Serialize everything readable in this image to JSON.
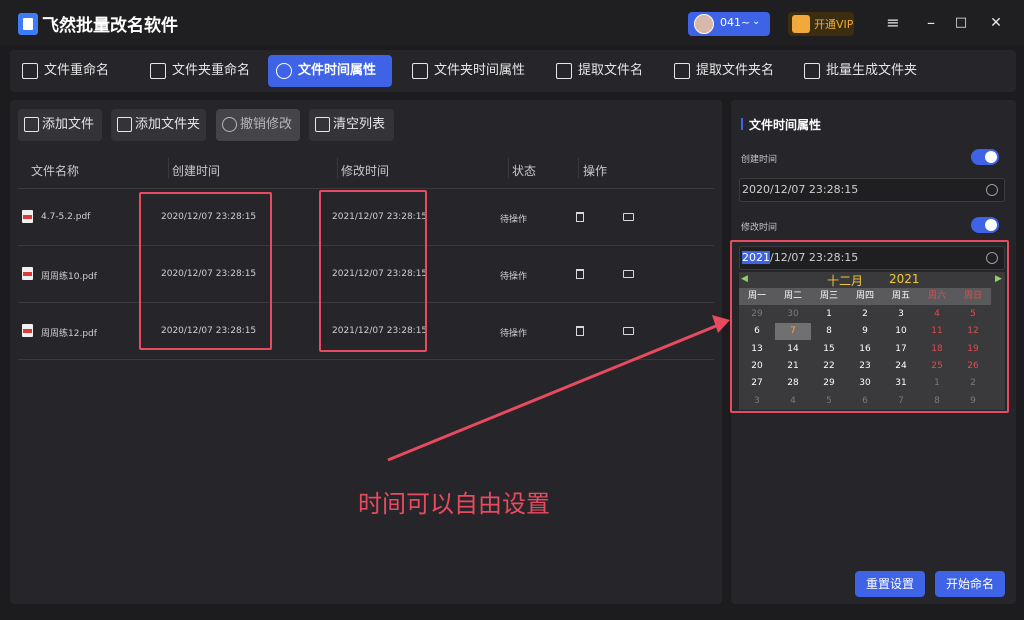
{
  "app": {
    "title": "飞然批量改名软件"
  },
  "user": {
    "name": "041~",
    "vip_label": "开通VIP"
  },
  "window_controls": [
    "≡",
    "–",
    "□",
    "✕"
  ],
  "tabs": [
    {
      "label": "文件重命名",
      "icon": "rename-file-icon"
    },
    {
      "label": "文件夹重命名",
      "icon": "terminal-icon"
    },
    {
      "label": "文件时间属性",
      "icon": "clock-file-icon",
      "active": true
    },
    {
      "label": "文件夹时间属性",
      "icon": "clock-folder-icon"
    },
    {
      "label": "提取文件名",
      "icon": "extract-file-icon"
    },
    {
      "label": "提取文件夹名",
      "icon": "extract-folder-icon"
    },
    {
      "label": "批量生成文件夹",
      "icon": "gear-folder-icon"
    }
  ],
  "toolbar": {
    "add_file": "添加文件",
    "add_folder": "添加文件夹",
    "undo": "撤销修改",
    "clear": "清空列表"
  },
  "table": {
    "headers": [
      "文件名称",
      "创建时间",
      "修改时间",
      "状态",
      "操作"
    ],
    "rows": [
      {
        "name": "4.7-5.2.pdf",
        "created": "2020/12/07 23:28:15",
        "modified": "2021/12/07 23:28:15",
        "status": "待操作"
      },
      {
        "name": "周周练10.pdf",
        "created": "2020/12/07 23:28:15",
        "modified": "2021/12/07 23:28:15",
        "status": "待操作"
      },
      {
        "name": "周周练12.pdf",
        "created": "2020/12/07 23:28:15",
        "modified": "2021/12/07 23:28:15",
        "status": "待操作"
      }
    ]
  },
  "annotation": "时间可以自由设置",
  "panel": {
    "title": "文件时间属性",
    "created_label": "创建时间",
    "created_value": "2020/12/07 23:28:15",
    "modified_label": "修改时间",
    "modified_year": "2021",
    "modified_rest": "/12/07 23:28:15",
    "created_enabled": true,
    "modified_enabled": true
  },
  "calendar": {
    "month": "十二月",
    "year": "2021",
    "weekdays": [
      "周一",
      "周二",
      "周三",
      "周四",
      "周五",
      "周六",
      "周日"
    ],
    "weeks": [
      [
        "29",
        "30",
        "1",
        "2",
        "3",
        "4",
        "5"
      ],
      [
        "6",
        "7",
        "8",
        "9",
        "10",
        "11",
        "12"
      ],
      [
        "13",
        "14",
        "15",
        "16",
        "17",
        "18",
        "19"
      ],
      [
        "20",
        "21",
        "22",
        "23",
        "24",
        "25",
        "26"
      ],
      [
        "27",
        "28",
        "29",
        "30",
        "31",
        "1",
        "2"
      ],
      [
        "3",
        "4",
        "5",
        "6",
        "7",
        "8",
        "9"
      ]
    ],
    "selected_day": "7"
  },
  "buttons": {
    "reset": "重置设置",
    "start": "开始命名"
  },
  "colors": {
    "accent": "#3f63e6",
    "highlight": "#e84a5f",
    "calendar_title": "#f2c83a"
  }
}
